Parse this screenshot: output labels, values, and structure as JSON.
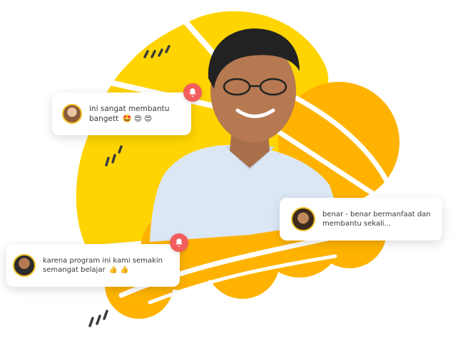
{
  "comments": [
    {
      "id": "top-left",
      "text": "ini sangat membantu bangett",
      "emoji": "🤩 😍 😍"
    },
    {
      "id": "right",
      "text": "benar - benar bermanfaat dan membantu sekali...",
      "emoji": ""
    },
    {
      "id": "bottom-left",
      "text": "karena program ini kami semakin semangat belajar",
      "emoji": "👍 👍"
    }
  ],
  "colors": {
    "yellow": "#ffd400",
    "orange": "#ffb300",
    "bell": "#f25d5d",
    "avatar_ring": "#f2c021"
  },
  "icons": [
    "bell-icon",
    "avatar"
  ]
}
